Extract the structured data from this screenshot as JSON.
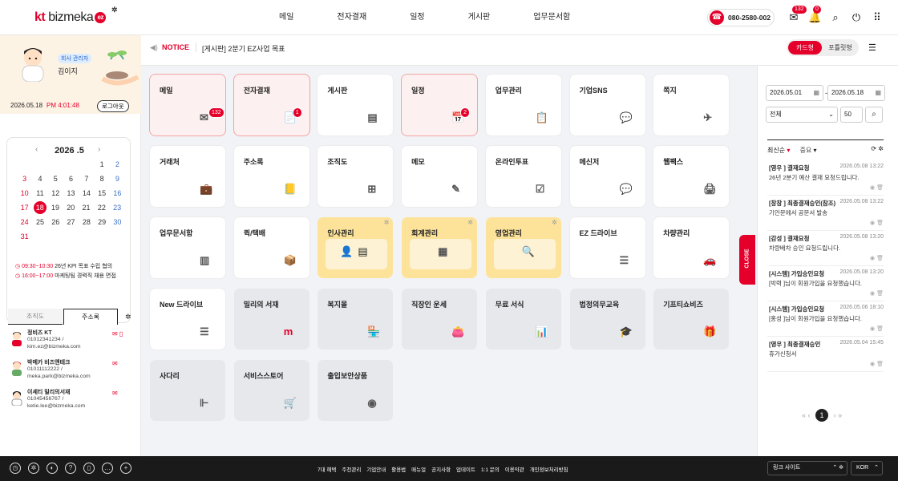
{
  "header": {
    "logo_kt": "kt",
    "logo_bizmeka": "bizmeka",
    "logo_ez": "ez",
    "nav": [
      "메일",
      "전자결재",
      "일정",
      "게시판",
      "업무문서함"
    ],
    "phone": "080-2580-002",
    "mail_count": "132",
    "alarm_count": "0"
  },
  "profile": {
    "role": "회사 관리자",
    "name": "김이지",
    "date": "2026.05.18",
    "time": "PM 4:01:48",
    "logout": "로그아웃"
  },
  "calendar": {
    "title": "2026 .5",
    "rows": [
      [
        "",
        "",
        "",
        "",
        "",
        "1",
        "2"
      ],
      [
        "3",
        "4",
        "5",
        "6",
        "7",
        "8",
        "9"
      ],
      [
        "10",
        "11",
        "12",
        "13",
        "14",
        "15",
        "16"
      ],
      [
        "17",
        "18",
        "19",
        "20",
        "21",
        "22",
        "23"
      ],
      [
        "24",
        "25",
        "26",
        "27",
        "28",
        "29",
        "30"
      ],
      [
        "31",
        "",
        "",
        "",
        "",
        "",
        ""
      ]
    ],
    "today": "18",
    "events": [
      {
        "time": "09:30~10:30",
        "text": "26년 KPI 목표 수립 협의"
      },
      {
        "time": "16:00~17:00",
        "text": "마케팅팀 경력직 채용 면접"
      }
    ]
  },
  "tabs": [
    "조직도",
    "주소록"
  ],
  "contacts": [
    {
      "name": "정비즈 KT",
      "phone": "01012341234 /",
      "email": "kim.ez@bizmeka.com"
    },
    {
      "name": "박메카 비즈앤테크",
      "phone": "01011112222 /",
      "email": "meka.park@bizmeka.com"
    },
    {
      "name": "이세티 밀리의서재",
      "phone": "01045456767 /",
      "email": "ketie.lee@bizmeka.com"
    }
  ],
  "notice": {
    "label": "NOTICE",
    "text": "[게시판] 2분기 EZ사업 목표"
  },
  "view": {
    "card": "카드형",
    "portlet": "포틀릿형"
  },
  "cards": [
    {
      "label": "메일",
      "icon": "✉",
      "badge": "132",
      "style": "hl"
    },
    {
      "label": "전자결재",
      "icon": "📄",
      "badge": "1",
      "style": "hl"
    },
    {
      "label": "게시판",
      "icon": "▤",
      "style": ""
    },
    {
      "label": "일정",
      "icon": "📅",
      "badge": "2",
      "style": "hl"
    },
    {
      "label": "업무관리",
      "icon": "📋",
      "style": ""
    },
    {
      "label": "기업SNS",
      "icon": "💬",
      "style": ""
    },
    {
      "label": "쪽지",
      "icon": "✈",
      "style": ""
    },
    {
      "label": "거래처",
      "icon": "💼",
      "style": ""
    },
    {
      "label": "주소록",
      "icon": "📒",
      "style": ""
    },
    {
      "label": "조직도",
      "icon": "⊞",
      "style": ""
    },
    {
      "label": "메모",
      "icon": "✎",
      "style": ""
    },
    {
      "label": "온라인투표",
      "icon": "☑",
      "style": ""
    },
    {
      "label": "메신저",
      "icon": "💬",
      "style": ""
    },
    {
      "label": "웹팩스",
      "icon": "🖨",
      "style": ""
    },
    {
      "label": "업무문서함",
      "icon": "▥",
      "style": ""
    },
    {
      "label": "퀵/택배",
      "icon": "📦",
      "style": ""
    },
    {
      "label": "인사관리",
      "icon": "👤",
      "style": "folder"
    },
    {
      "label": "회계관리",
      "icon": "▦",
      "style": "folder"
    },
    {
      "label": "영업관리",
      "icon": "🔍",
      "style": "folder"
    },
    {
      "label": "EZ 드라이브",
      "icon": "☰",
      "style": ""
    },
    {
      "label": "차량관리",
      "icon": "🚗",
      "style": ""
    },
    {
      "label": "New 드라이브",
      "icon": "☰",
      "style": ""
    },
    {
      "label": "밀리의 서재",
      "icon": "m",
      "style": "grey"
    },
    {
      "label": "복지몰",
      "icon": "🏪",
      "style": "grey"
    },
    {
      "label": "직장인 운세",
      "icon": "👛",
      "style": "grey"
    },
    {
      "label": "무료 서식",
      "icon": "📊",
      "style": "grey"
    },
    {
      "label": "법정의무교육",
      "icon": "🎓",
      "style": "grey"
    },
    {
      "label": "기프티쇼비즈",
      "icon": "🎁",
      "style": "grey"
    },
    {
      "label": "사다리",
      "icon": "⊩",
      "style": "grey"
    },
    {
      "label": "서비스스토어",
      "icon": "🛒",
      "style": "grey"
    },
    {
      "label": "출입보안상품",
      "icon": "◉",
      "style": "grey"
    }
  ],
  "close": "CLOSE",
  "panel": {
    "date_from": "2026.05.01",
    "date_to": "2026.05.18",
    "filter": "전체",
    "size": "50",
    "sort1": "최신순",
    "sort2": "중요",
    "items": [
      {
        "title": "[영우 ] 결재요청",
        "date": "2026.05.08 13:22",
        "body": "26년 2분기 예산 결재 요청드립니다."
      },
      {
        "title": "[창창 ] 최종결재승인(참조)",
        "date": "2026.05.08 13:22",
        "body": "기안문에서 공문서 발송"
      },
      {
        "title": "[감성 ] 결재요청",
        "date": "2026.05.08 13:20",
        "body": "차량배차 승인 요청드립니다."
      },
      {
        "title": "[시스템] 가입승인요청",
        "date": "2026.05.08 13:20",
        "body": "[박력 ]님이 회원가입을 요청했습니다."
      },
      {
        "title": "[시스템] 가입승인요청",
        "date": "2026.05.06 18:10",
        "body": "[홍성 ]님이 회원가입을 요청했습니다."
      },
      {
        "title": "[영우 ] 최종결재승인",
        "date": "2026.05.04 15:45",
        "body": "휴가신청서"
      }
    ],
    "page": "1"
  },
  "footer": {
    "links": [
      "7대 혜택",
      "주천관리",
      "기업안내",
      "활용법",
      "매뉴얼",
      "공지사항",
      "업데이트",
      "1:1 문의",
      "이용약관",
      "개인정보처리방침"
    ],
    "site": "링크 사이트",
    "lang": "KOR"
  }
}
